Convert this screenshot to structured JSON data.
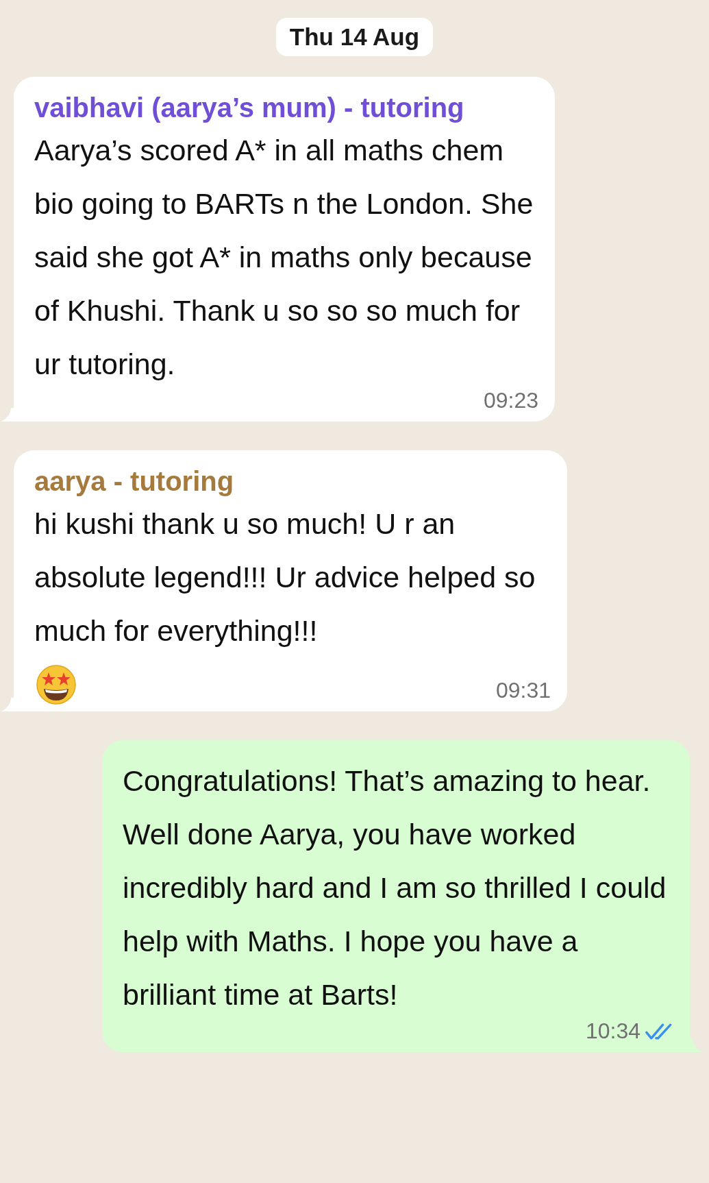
{
  "date": "Thu 14 Aug",
  "messages": [
    {
      "kind": "incoming",
      "sender": "vaibhavi (aarya’s mum) - tutoring",
      "color": "#6e4fd6",
      "text": "Aarya’s scored A* in all maths chem bio going to BARTs n the London. She said she got A* in maths only because of Khushi. Thank u so so so much for ur tutoring.",
      "emoji": false,
      "time": "09:23"
    },
    {
      "kind": "incoming",
      "sender": "aarya - tutoring",
      "color": "#a57a3c",
      "text": "hi kushi thank u so much! U r an absolute legend!!! Ur advice helped so much for everything!!!",
      "emoji": true,
      "time": "09:31"
    },
    {
      "kind": "outgoing",
      "text": "Congratulations! That’s amazing to hear. Well done Aarya, you have worked incredibly hard and I am so thrilled I could help with Maths. I hope you have a brilliant time at Barts!",
      "time": "10:34",
      "read": true
    }
  ]
}
